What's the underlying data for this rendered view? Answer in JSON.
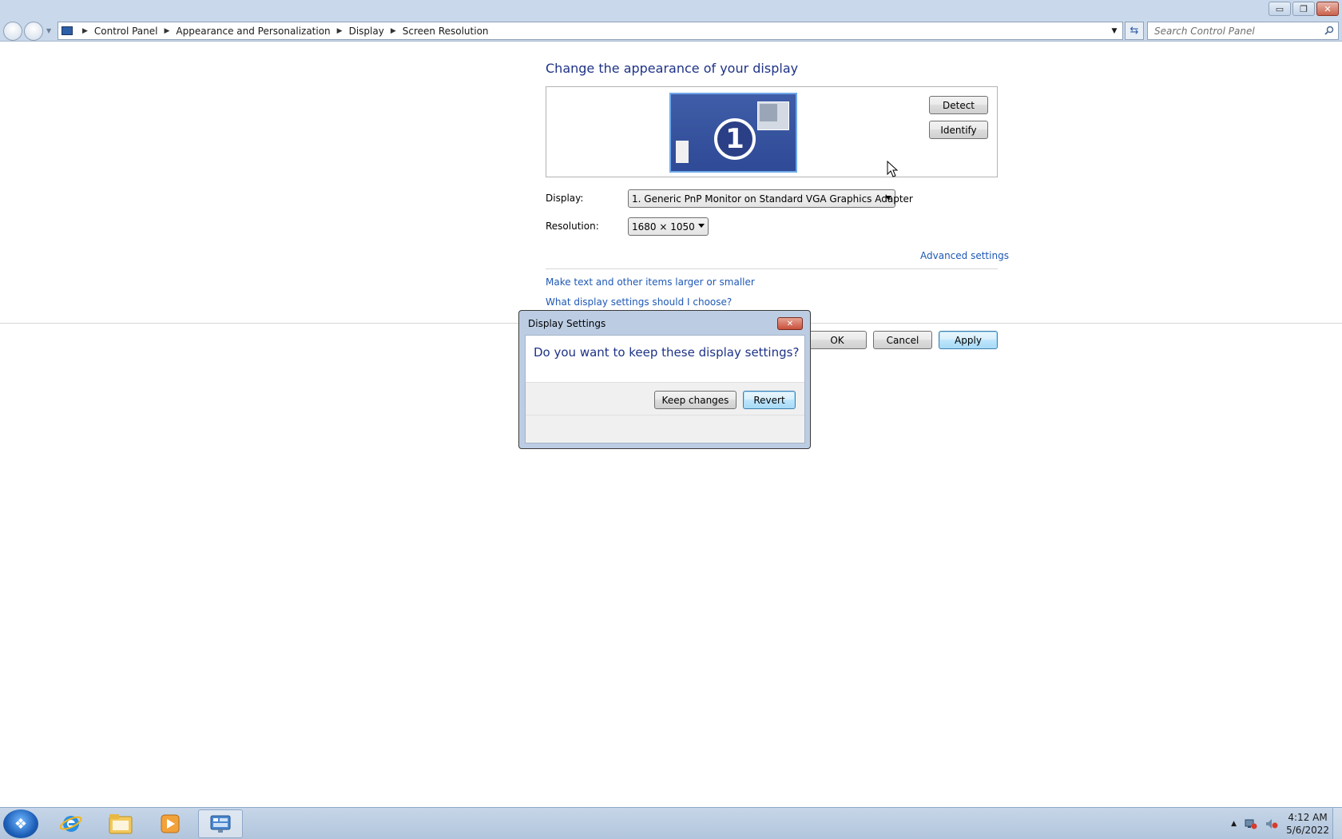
{
  "window": {
    "buttons": {
      "minimize": "▭",
      "restore": "❐",
      "close": "✕"
    }
  },
  "nav": {
    "breadcrumbs": [
      "Control Panel",
      "Appearance and Personalization",
      "Display",
      "Screen Resolution"
    ],
    "search_placeholder": "Search Control Panel"
  },
  "page": {
    "heading": "Change the appearance of your display",
    "monitor_number": "1",
    "detect_label": "Detect",
    "identify_label": "Identify",
    "display_label": "Display:",
    "display_value": "1. Generic PnP Monitor on Standard VGA Graphics Adapter",
    "resolution_label": "Resolution:",
    "resolution_value": "1680 × 1050",
    "advanced_link": "Advanced settings",
    "link_text_size": "Make text and other items larger or smaller",
    "link_help": "What display settings should I choose?",
    "ok_label": "OK",
    "cancel_label": "Cancel",
    "apply_label": "Apply"
  },
  "dialog": {
    "title": "Display Settings",
    "close_glyph": "✕",
    "question": "Do you want to keep these display settings?",
    "keep_label": "Keep changes",
    "revert_label": "Revert"
  },
  "taskbar": {
    "items": [
      "start-orb",
      "internet-explorer",
      "windows-explorer",
      "media-player",
      "control-panel"
    ],
    "clock_time": "4:12 AM",
    "clock_date": "5/6/2022"
  },
  "colors": {
    "heading": "#1e3287",
    "link": "#1e58b5",
    "chrome": "#c9d8ea"
  }
}
